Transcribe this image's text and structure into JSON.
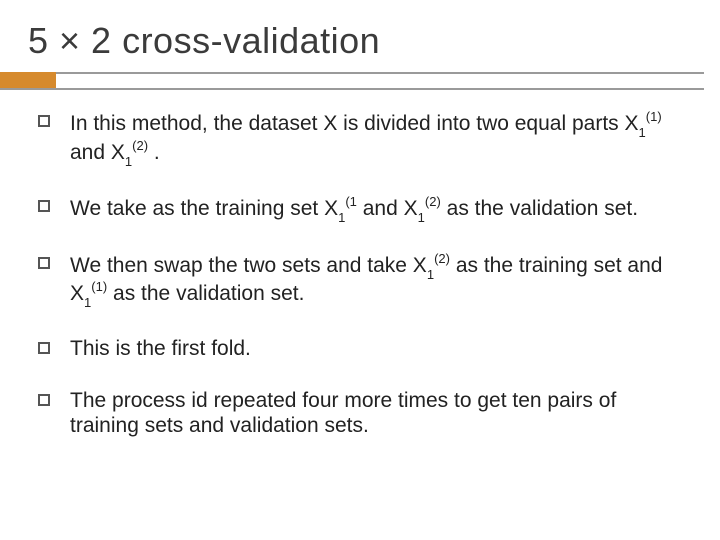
{
  "title": "5 × 2 cross-validation",
  "bullets": {
    "b0": {
      "a": "In this method, the dataset X is divided into two equal parts X",
      "sub0": "1",
      "sup0": "(1)",
      "b": " and X",
      "sub1": "1",
      "sup1": "(2)",
      "c": " ."
    },
    "b1": {
      "a": "We take as the training set X",
      "sub0": "1",
      "sup0": "(1",
      "b": " and X",
      "sub1": "1",
      "sup1": "(2)",
      "c": "  as the validation set."
    },
    "b2": {
      "a": "We then swap the two sets and take X",
      "sub0": "1",
      "sup0": "(2)",
      "b": "  as the training set and X",
      "sub1": "1",
      "sup1": "(1)",
      "c": "  as the validation set."
    },
    "b3": "This is the first fold.",
    "b4": "The process id repeated four more times to get ten pairs of training sets and validation sets."
  }
}
